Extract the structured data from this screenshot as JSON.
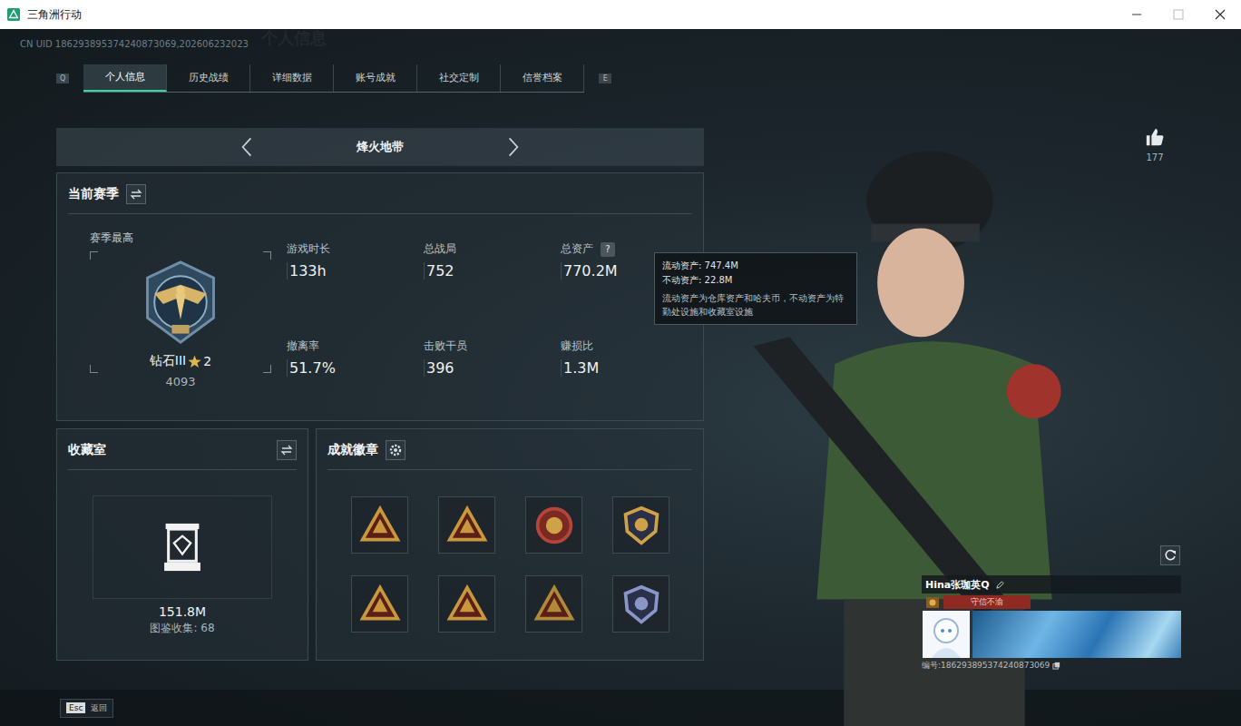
{
  "window": {
    "title": "三角洲行动"
  },
  "uid": "CN UID 186293895374240873069,202606232023",
  "watermark": "个人信息",
  "tab_keys": {
    "prev": "Q",
    "next": "E"
  },
  "tabs": [
    {
      "label": "个人信息",
      "selected": true
    },
    {
      "label": "历史战绩",
      "selected": false
    },
    {
      "label": "详细数据",
      "selected": false
    },
    {
      "label": "账号成就",
      "selected": false
    },
    {
      "label": "社交定制",
      "selected": false
    },
    {
      "label": "信誉档案",
      "selected": false
    }
  ],
  "mode": {
    "label": "烽火地带"
  },
  "season": {
    "title": "当前赛季",
    "best_label": "赛季最高",
    "rank": "钻石III",
    "star_count": "2",
    "score": "4093"
  },
  "help_glyph": "?",
  "stats": [
    {
      "label": "游戏时长",
      "value": "133h",
      "help": false
    },
    {
      "label": "总战局",
      "value": "752",
      "help": false
    },
    {
      "label": "总资产",
      "value": "770.2M",
      "help": true
    },
    {
      "label": "撤离率",
      "value": "51.7%",
      "help": false
    },
    {
      "label": "击败干员",
      "value": "396",
      "help": false
    },
    {
      "label": "赚损比",
      "value": "1.3M",
      "help": false
    }
  ],
  "tooltip": {
    "lines": [
      "流动资产: 747.4M",
      "不动资产: 22.8M"
    ],
    "note": "流动资产为仓库资产和哈夫币，不动资产为特勤处设施和收藏室设施"
  },
  "collection": {
    "title": "收藏室",
    "value": "151.8M",
    "caption": "图鉴收集: 68"
  },
  "achievements": {
    "title": "成就徽章",
    "badges": [
      {
        "kind": "triangle",
        "color": "#c9973e"
      },
      {
        "kind": "triangle",
        "color": "#c9973e"
      },
      {
        "kind": "round",
        "color": "#b5453a"
      },
      {
        "kind": "shield",
        "color": "#d0a248"
      },
      {
        "kind": "triangle",
        "color": "#c9973e"
      },
      {
        "kind": "triangle",
        "color": "#c9973e"
      },
      {
        "kind": "triangle",
        "color": "#b08a3a"
      },
      {
        "kind": "shield",
        "color": "#8a96c8"
      }
    ]
  },
  "likes": "177",
  "profile": {
    "name": "Hina张珈英Q",
    "tag": "守信不渝",
    "id_line": "编号:186293895374240873069"
  },
  "footer": {
    "key": "Esc",
    "label": "返回"
  }
}
